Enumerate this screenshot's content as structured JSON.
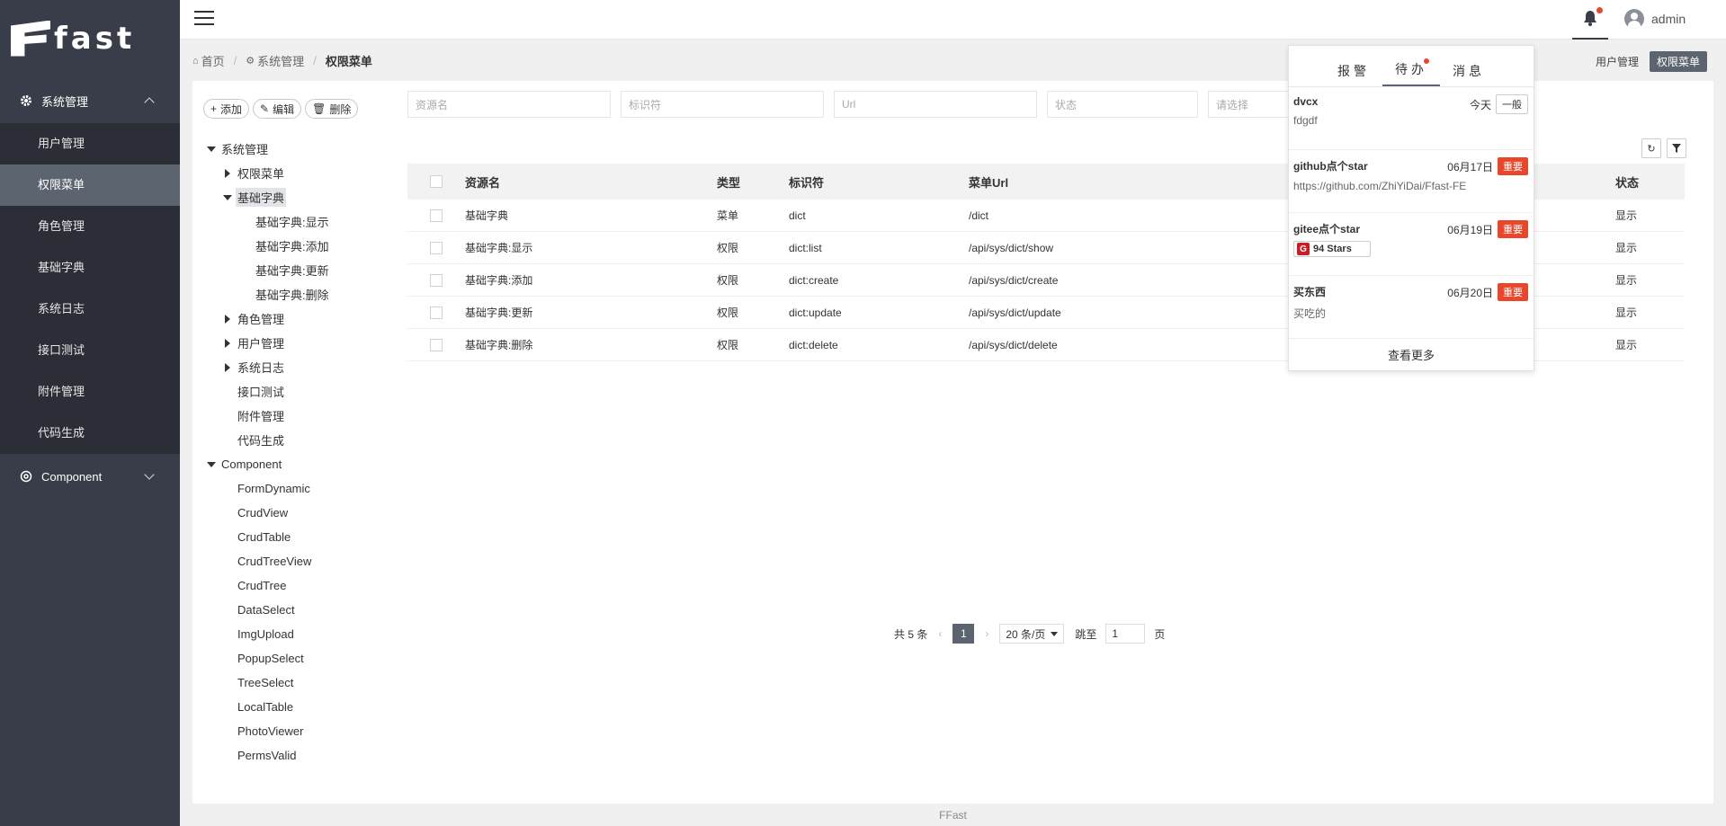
{
  "brand": {
    "name": "fast"
  },
  "sidebar": {
    "groups": [
      {
        "label": "系统管理",
        "icon": "gear-icon",
        "expanded": true,
        "items": [
          "用户管理",
          "权限菜单",
          "角色管理",
          "基础字典",
          "系统日志",
          "接口测试",
          "附件管理",
          "代码生成"
        ],
        "active_index": 1
      },
      {
        "label": "Component",
        "icon": "component-icon",
        "expanded": false
      }
    ]
  },
  "header": {
    "user": "admin"
  },
  "breadcrumb": {
    "home": "首页",
    "parent": "系统管理",
    "current": "权限菜单"
  },
  "open_tabs": [
    "用户管理",
    "权限菜单"
  ],
  "toolbar": {
    "add": "添加",
    "edit": "编辑",
    "delete": "删除"
  },
  "tree": [
    {
      "label": "系统管理",
      "level": 0,
      "arrow": "down"
    },
    {
      "label": "权限菜单",
      "level": 1,
      "arrow": "right"
    },
    {
      "label": "基础字典",
      "level": 1,
      "arrow": "down",
      "selected": true
    },
    {
      "label": "基础字典:显示",
      "level": 2,
      "arrow": "none"
    },
    {
      "label": "基础字典:添加",
      "level": 2,
      "arrow": "none"
    },
    {
      "label": "基础字典:更新",
      "level": 2,
      "arrow": "none"
    },
    {
      "label": "基础字典:删除",
      "level": 2,
      "arrow": "none"
    },
    {
      "label": "角色管理",
      "level": 1,
      "arrow": "right"
    },
    {
      "label": "用户管理",
      "level": 1,
      "arrow": "right"
    },
    {
      "label": "系统日志",
      "level": 1,
      "arrow": "right"
    },
    {
      "label": "接口测试",
      "level": 1,
      "arrow": "none"
    },
    {
      "label": "附件管理",
      "level": 1,
      "arrow": "none"
    },
    {
      "label": "代码生成",
      "level": 1,
      "arrow": "none"
    },
    {
      "label": "Component",
      "level": 0,
      "arrow": "down"
    },
    {
      "label": "FormDynamic",
      "level": 1,
      "arrow": "none"
    },
    {
      "label": "CrudView",
      "level": 1,
      "arrow": "none"
    },
    {
      "label": "CrudTable",
      "level": 1,
      "arrow": "none"
    },
    {
      "label": "CrudTreeView",
      "level": 1,
      "arrow": "none"
    },
    {
      "label": "CrudTree",
      "level": 1,
      "arrow": "none"
    },
    {
      "label": "DataSelect",
      "level": 1,
      "arrow": "none"
    },
    {
      "label": "ImgUpload",
      "level": 1,
      "arrow": "none"
    },
    {
      "label": "PopupSelect",
      "level": 1,
      "arrow": "none"
    },
    {
      "label": "TreeSelect",
      "level": 1,
      "arrow": "none"
    },
    {
      "label": "LocalTable",
      "level": 1,
      "arrow": "none"
    },
    {
      "label": "PhotoViewer",
      "level": 1,
      "arrow": "none"
    },
    {
      "label": "PermsValid",
      "level": 1,
      "arrow": "none"
    }
  ],
  "filters": [
    {
      "placeholder": "资源名"
    },
    {
      "placeholder": "标识符"
    },
    {
      "placeholder": "Url"
    },
    {
      "placeholder": "状态"
    },
    {
      "placeholder": "请选择"
    }
  ],
  "table": {
    "columns": [
      "资源名",
      "类型",
      "标识符",
      "菜单Url",
      "",
      "状态"
    ],
    "rows": [
      [
        "基础字典",
        "菜单",
        "dict",
        "/dict",
        "显示"
      ],
      [
        "基础字典:显示",
        "权限",
        "dict:list",
        "/api/sys/dict/show",
        "显示"
      ],
      [
        "基础字典:添加",
        "权限",
        "dict:create",
        "/api/sys/dict/create",
        "显示"
      ],
      [
        "基础字典:更新",
        "权限",
        "dict:update",
        "/api/sys/dict/update",
        "显示"
      ],
      [
        "基础字典:删除",
        "权限",
        "dict:delete",
        "/api/sys/dict/delete",
        "显示"
      ]
    ]
  },
  "pagination": {
    "total": "共 5 条",
    "current": "1",
    "page_size": "20 条/页",
    "jump_label": "跳至",
    "jump_value": "1",
    "page_unit": "页"
  },
  "footer": "FFast",
  "notifications": {
    "tabs": [
      "报警",
      "待办",
      "消息"
    ],
    "active_tab": 1,
    "items": [
      {
        "title": "dvcx",
        "body": "fdgdf",
        "date": "今天",
        "tag": "一般",
        "tag_type": "normal"
      },
      {
        "title": "github点个star",
        "body": "https://github.com/ZhiYiDai/Ffast-FE",
        "date": "06月17日",
        "tag": "重要",
        "tag_type": "important"
      },
      {
        "title": "gitee点个star",
        "badge": "94 Stars",
        "date": "06月19日",
        "tag": "重要",
        "tag_type": "important"
      },
      {
        "title": "买东西",
        "body": "买吃的",
        "date": "06月20日",
        "tag": "重要",
        "tag_type": "important"
      }
    ],
    "more": "查看更多"
  },
  "colors": {
    "sidebar_bg": "#393d49",
    "sidebar_active": "#5c6470",
    "important": "#e8472c"
  }
}
